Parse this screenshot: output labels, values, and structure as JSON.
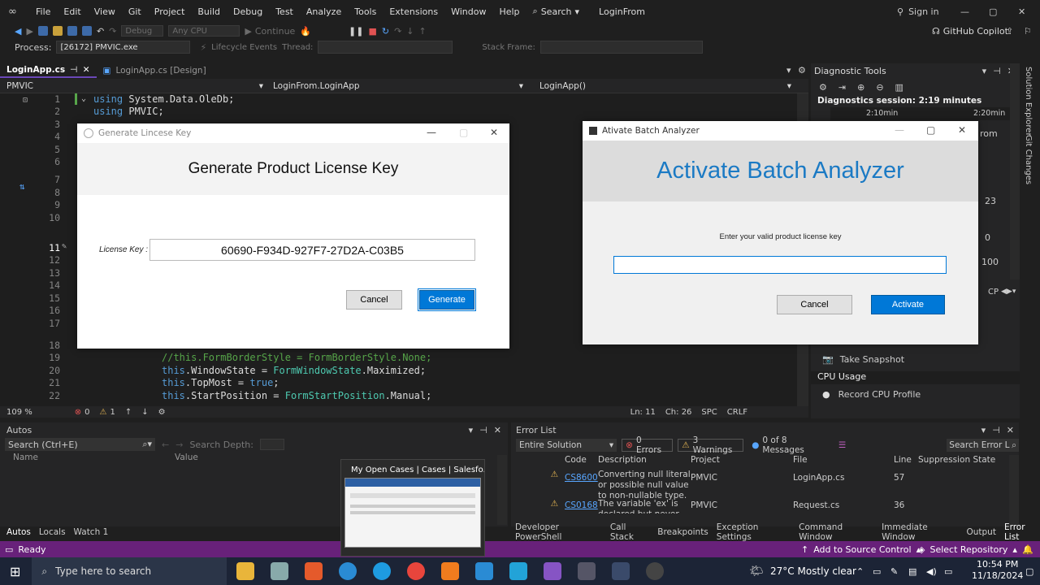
{
  "menu": [
    "File",
    "Edit",
    "View",
    "Git",
    "Project",
    "Build",
    "Debug",
    "Test",
    "Analyze",
    "Tools",
    "Extensions",
    "Window",
    "Help"
  ],
  "search_label": "Search",
  "window_title": "LoginFrom",
  "sign_in": "Sign in",
  "toolbar": {
    "config": "Debug",
    "platform": "Any CPU",
    "continue": "Continue",
    "copilot": "GitHub Copilot"
  },
  "process": {
    "label": "Process:",
    "value": "[26172] PMVIC.exe",
    "lifecycle": "Lifecycle Events",
    "thread": "Thread:",
    "stack": "Stack Frame:"
  },
  "tabs": [
    {
      "label": "LoginApp.cs"
    },
    {
      "label": "LoginApp.cs [Design]"
    }
  ],
  "nav": {
    "project": "PMVIC",
    "class": "LoginFrom.LoginApp",
    "member": "LoginApp()"
  },
  "code_lines": [
    {
      "n": "1",
      "text": "using System.Data.OleDb;"
    },
    {
      "n": "2",
      "text": "using PMVIC;"
    },
    {
      "n": "3",
      "text": ""
    },
    {
      "n": "4",
      "text": ""
    },
    {
      "n": "5",
      "text": ""
    },
    {
      "n": "6",
      "text": ""
    },
    {
      "n": "7",
      "text": ""
    },
    {
      "n": "8",
      "text": ""
    },
    {
      "n": "9",
      "text": ""
    },
    {
      "n": "10",
      "text": ""
    },
    {
      "n": "11",
      "text": ""
    },
    {
      "n": "12",
      "text": ""
    },
    {
      "n": "13",
      "text": ""
    },
    {
      "n": "14",
      "text": ""
    },
    {
      "n": "15",
      "text": ""
    },
    {
      "n": "16",
      "text": ""
    },
    {
      "n": "17",
      "text": ""
    },
    {
      "n": "18",
      "text": ""
    },
    {
      "n": "19",
      "text": "//this.FormBorderStyle = FormBorderStyle.None;"
    },
    {
      "n": "20",
      "text": "this.WindowState = FormWindowState.Maximized;"
    },
    {
      "n": "21",
      "text": "this.TopMost = true;"
    },
    {
      "n": "22",
      "text": "this.StartPosition = FormStartPosition.Manual;"
    }
  ],
  "editor_status": {
    "zoom": "109 %",
    "errors": "0",
    "warnings": "1",
    "ln": "Ln: 11",
    "ch": "Ch: 26",
    "spc": "SPC",
    "crlf": "CRLF"
  },
  "diag": {
    "title": "Diagnostic Tools",
    "session": "Diagnostics session: 2:19 minutes",
    "t1": "2:10min",
    "t2": "2:20min",
    "v1": "23",
    "v2": "0",
    "v3": "100",
    "snapshot": "Take Snapshot",
    "cpu": "CPU Usage",
    "record": "Record CPU Profile",
    "partial_rom": "rom",
    "partial_cp": "CP"
  },
  "right_strip": [
    "Solution Explorer",
    "Git Changes"
  ],
  "autos": {
    "title": "Autos",
    "search": "Search (Ctrl+E)",
    "depth": "Search Depth:",
    "col_name": "Name",
    "col_value": "Value",
    "tabs": [
      "Autos",
      "Locals",
      "Watch 1"
    ]
  },
  "errorlist": {
    "title": "Error List",
    "scope": "Entire Solution",
    "errors": "0 Errors",
    "warnings": "3 Warnings",
    "messages": "0 of 8 Messages",
    "search": "Search Error L",
    "cols": [
      "Code",
      "Description",
      "Project",
      "File",
      "Line",
      "Suppression State"
    ],
    "rows": [
      {
        "code": "CS8600",
        "desc": "Converting null literal or possible null value to non-nullable type.",
        "project": "PMVIC",
        "file": "LoginApp.cs",
        "line": "57"
      },
      {
        "code": "CS0168",
        "desc": "The variable 'ex' is declared but never used",
        "project": "PMVIC",
        "file": "Request.cs",
        "line": "36"
      }
    ],
    "tabs": [
      "Developer PowerShell",
      "Call Stack",
      "Breakpoints",
      "Exception Settings",
      "Command Window",
      "Immediate Window",
      "Output",
      "Error List"
    ]
  },
  "status": {
    "ready": "Ready",
    "source": "Add to Source Control",
    "repo": "Select Repository"
  },
  "license_dialog": {
    "title": "Generate Lincese Key",
    "header": "Generate Product License Key",
    "label": "License Key :",
    "key": "60690-F934D-927F7-27D2A-C03B5",
    "cancel": "Cancel",
    "generate": "Generate"
  },
  "activate_dialog": {
    "title": "Ativate Batch Analyzer",
    "header": "Activate Batch Analyzer",
    "prompt": "Enter your valid product license key",
    "input": "",
    "cancel": "Cancel",
    "activate": "Activate"
  },
  "thumb": {
    "title": "My Open Cases | Cases | Salesfo..."
  },
  "taskbar": {
    "search": "Type here to search",
    "weather": "27°C  Mostly clear",
    "time": "10:54 PM",
    "date": "11/18/2024"
  },
  "colors": {
    "accent": "#68217a",
    "blue_btn": "#0078d7",
    "title_blue": "#1b7ac4"
  }
}
